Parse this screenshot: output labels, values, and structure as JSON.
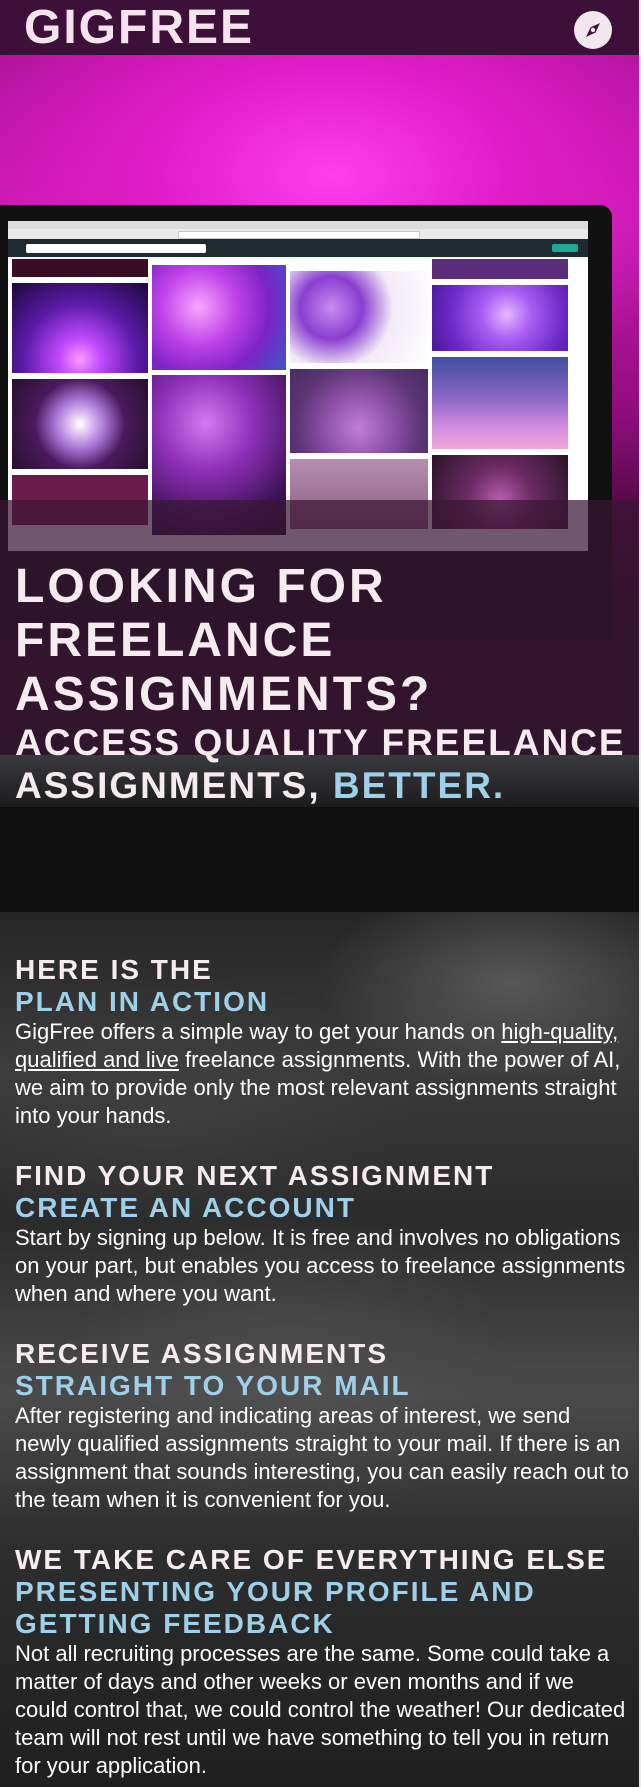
{
  "header": {
    "brand": "GIGFREE",
    "nav_icon": "compass-icon"
  },
  "hero": {
    "title": "LOOKING FOR FREELANCE ASSIGNMENTS?",
    "subtitle_prefix": "ACCESS QUALITY FREELANCE ASSIGNMENTS, ",
    "subtitle_accent": "BETTER."
  },
  "sections": [
    {
      "heading": "HERE IS THE",
      "subheading": "PLAN IN ACTION",
      "body_before": "GigFree offers a simple way to get your hands on ",
      "body_link": "high-quality, qualified and live",
      "body_after": " freelance assignments. With the power of AI, we aim to provide only the most relevant assignments straight into your hands."
    },
    {
      "heading": "FIND YOUR NEXT ASSIGNMENT",
      "subheading": "CREATE AN ACCOUNT",
      "body": "Start by signing up below. It is free and involves no obligations on your part, but enables you access to freelance assignments when and where you want."
    },
    {
      "heading": "RECEIVE ASSIGNMENTS",
      "subheading": "STRAIGHT TO YOUR MAIL",
      "body": "After registering and indicating areas of interest, we send newly qualified assignments straight to your mail. If there is an assignment that sounds interesting, you can easily reach out to the team when it is convenient for you."
    },
    {
      "heading": "WE TAKE CARE OF EVERYTHING ELSE",
      "subheading": "PRESENTING YOUR PROFILE AND GETTING FEEDBACK",
      "body": "Not all recruiting processes are the same. Some could take a matter of days and other weeks or even months and if we could control that, we could control the weather! Our dedicated team will not rest until we have something to tell you in return for your application."
    }
  ],
  "colors": {
    "header_bg": "#3d1039",
    "accent": "#9fd0ea",
    "hero_magenta": "#c81bb1",
    "text_light": "#f6ecef"
  }
}
